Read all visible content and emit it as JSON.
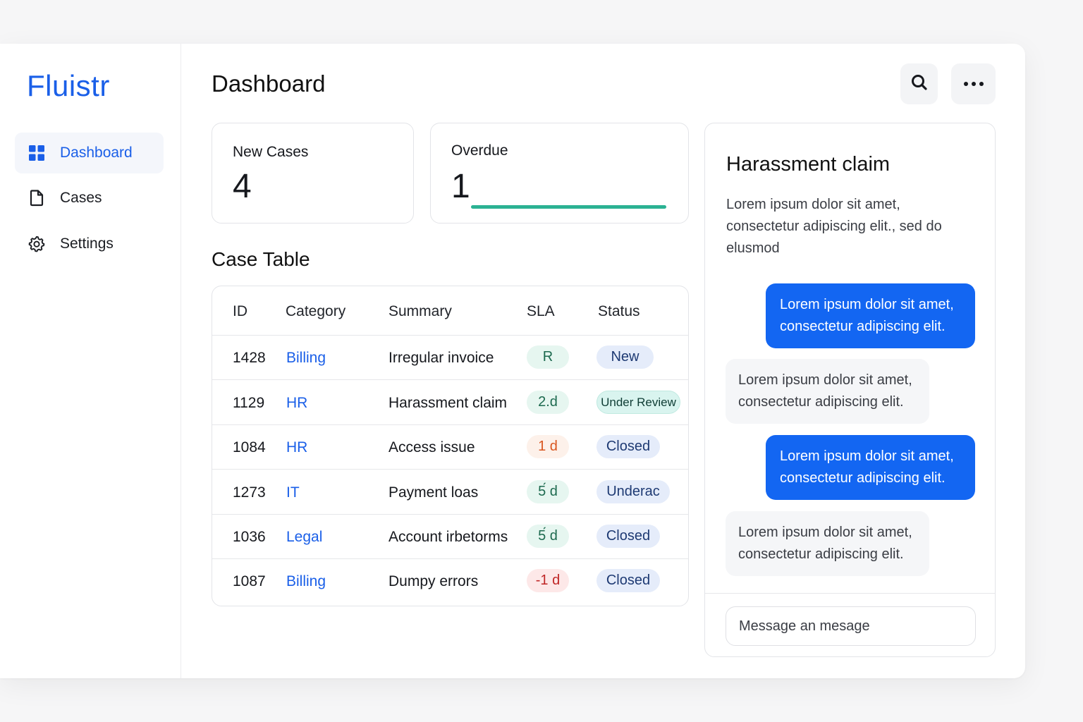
{
  "app": {
    "name": "Fluistr"
  },
  "sidebar": {
    "items": [
      {
        "label": "Dashboard",
        "icon": "grid-icon",
        "active": true
      },
      {
        "label": "Cases",
        "icon": "document-icon",
        "active": false
      },
      {
        "label": "Settings",
        "icon": "gear-icon",
        "active": false
      }
    ]
  },
  "header": {
    "title": "Dashboard",
    "search_icon": "search-icon",
    "more_icon": "more-icon"
  },
  "stats": {
    "new_cases": {
      "label": "New Cases",
      "value": "4"
    },
    "overdue": {
      "label": "Overdue",
      "value": "1",
      "progress": 1.0
    }
  },
  "case_table": {
    "title": "Case Table",
    "columns": [
      "ID",
      "Category",
      "Summary",
      "SLA",
      "Status"
    ],
    "rows": [
      {
        "id": "1428",
        "category": "Billing",
        "summary": "Irregular invoice",
        "sla": "R",
        "sla_tone": "green",
        "status": "New",
        "status_tone": "blue"
      },
      {
        "id": "1129",
        "category": "HR",
        "summary": "Harassment claim",
        "sla": "2.d",
        "sla_tone": "green",
        "status": "Under Review",
        "status_tone": "teal"
      },
      {
        "id": "1084",
        "category": "HR",
        "summary": "Access issue",
        "sla": "1 d",
        "sla_tone": "orange",
        "status": "Closed",
        "status_tone": "blue"
      },
      {
        "id": "1273",
        "category": "IT",
        "summary": "Payment loas",
        "sla": "5́ d",
        "sla_tone": "green",
        "status": "Underac",
        "status_tone": "blue"
      },
      {
        "id": "1036",
        "category": "Legal",
        "summary": "Account irbetorms",
        "sla": "5́ d",
        "sla_tone": "green",
        "status": "Closed",
        "status_tone": "blue"
      },
      {
        "id": "1087",
        "category": "Billing",
        "summary": "Dumpy errors",
        "sla": "-1 d",
        "sla_tone": "red",
        "status": "Closed",
        "status_tone": "blue"
      }
    ]
  },
  "chat": {
    "title": "Harassment claim",
    "description": "Lorem ipsum dolor sit amet, consectetur adipiscing elit., sed do elusmod",
    "messages": [
      {
        "direction": "out",
        "text": "Lorem ipsum dolor sit amet, consectetur adipiscing elit."
      },
      {
        "direction": "in",
        "text": "Lorem ipsum dolor sit amet, consectetur adipiscing elit."
      },
      {
        "direction": "out",
        "text": "Lorem ipsum dolor sit amet, consectetur adipiscing elit."
      },
      {
        "direction": "in",
        "text": "Lorem ipsum dolor sit amet, consectetur adipiscing elit."
      }
    ],
    "input_placeholder": "Message an mesage"
  },
  "colors": {
    "accent": "#1a5fe8",
    "bubble_out": "#1366f2",
    "progress": "#2bb293",
    "pill_green_bg": "#e6f6f0",
    "pill_green_fg": "#1d6a4f",
    "pill_orange_bg": "#fdf1ea",
    "pill_orange_fg": "#d9561f",
    "pill_red_bg": "#fde8e8",
    "pill_red_fg": "#c02626",
    "pill_blue_bg": "#e5ecfa",
    "pill_blue_fg": "#1e3a73",
    "pill_teal_bg": "#d9f4ef",
    "pill_teal_fg": "#0f3d35"
  }
}
